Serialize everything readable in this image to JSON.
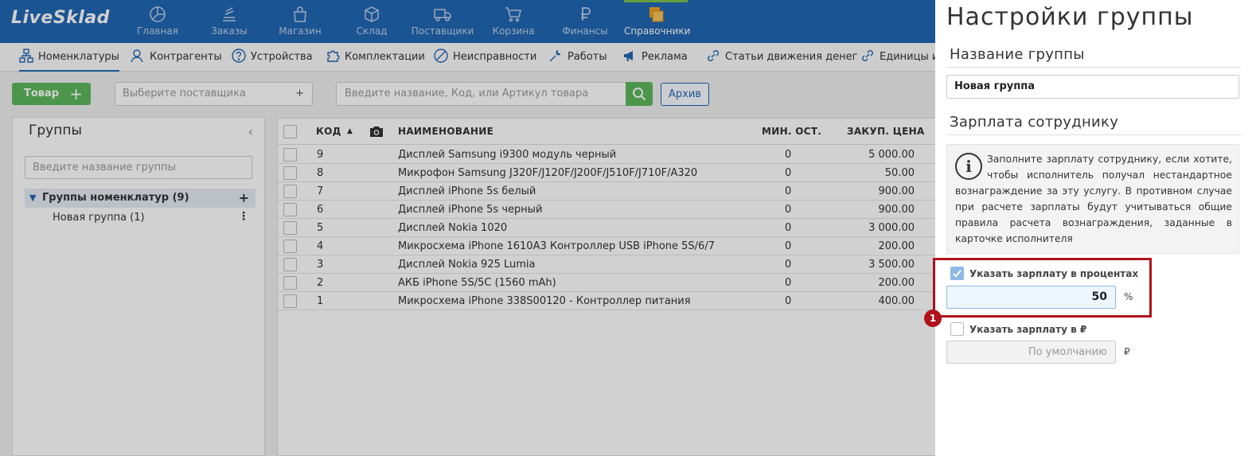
{
  "app": {
    "logo": "LiveSklad"
  },
  "nav": [
    {
      "label": "Главная",
      "icon": "pie-chart-icon"
    },
    {
      "label": "Заказы",
      "icon": "stack-icon"
    },
    {
      "label": "Магазин",
      "icon": "shopping-bag-icon"
    },
    {
      "label": "Склад",
      "icon": "box-icon"
    },
    {
      "label": "Поставщики",
      "icon": "truck-icon"
    },
    {
      "label": "Корзина",
      "icon": "cart-icon"
    },
    {
      "label": "Финансы",
      "icon": "ruble-icon"
    },
    {
      "label": "Справочники",
      "icon": "reference-icon",
      "active": true
    }
  ],
  "subnav": [
    {
      "label": "Номенклатуры",
      "icon": "nomenclature-icon",
      "active": true
    },
    {
      "label": "Контрагенты",
      "icon": "person-icon"
    },
    {
      "label": "Устройства",
      "icon": "question-circle-icon"
    },
    {
      "label": "Комплектации",
      "icon": "puzzle-icon"
    },
    {
      "label": "Неисправности",
      "icon": "forbidden-icon"
    },
    {
      "label": "Работы",
      "icon": "wrench-icon"
    },
    {
      "label": "Реклама",
      "icon": "megaphone-icon"
    },
    {
      "label": "Статьи движения денег",
      "icon": "link-icon"
    },
    {
      "label": "Единицы из",
      "icon": "link-icon"
    }
  ],
  "toolbar": {
    "add_label": "Товар",
    "add_plus": "+",
    "supplier_placeholder": "Выберите поставщика",
    "supplier_plus": "+",
    "search_placeholder": "Введите название, Код, или Артикул товара",
    "archive_label": "Архив"
  },
  "groups": {
    "title": "Группы",
    "collapse": "‹",
    "search_placeholder": "Введите название группы",
    "root": {
      "label": "Группы номенклатур (9)",
      "chevron": "▼",
      "plus": "+"
    },
    "child": {
      "label": "Новая группа (1)",
      "menu": "⋮"
    }
  },
  "table": {
    "headers": {
      "code": "КОД",
      "sort": "▲",
      "name": "НАИМЕНОВАНИЕ",
      "min_stock": "МИН. ОСТ.",
      "purchase_price": "ЗАКУП. ЦЕНА"
    },
    "rows": [
      {
        "code": "9",
        "name": "Дисплей Samsung i9300 модуль черный",
        "min": "0",
        "price": "5 000.00"
      },
      {
        "code": "8",
        "name": "Микрофон Samsung J320F/J120F/J200F/J510F/J710F/A320",
        "min": "0",
        "price": "50.00"
      },
      {
        "code": "7",
        "name": "Дисплей iPhone 5s белый",
        "min": "0",
        "price": "900.00"
      },
      {
        "code": "6",
        "name": "Дисплей iPhone 5s черный",
        "min": "0",
        "price": "900.00"
      },
      {
        "code": "5",
        "name": "Дисплей Nokia 1020",
        "min": "0",
        "price": "3 000.00"
      },
      {
        "code": "4",
        "name": "Микросхема iPhone 1610A3 Контроллер USB iPhone 5S/6/7",
        "min": "0",
        "price": "200.00"
      },
      {
        "code": "3",
        "name": "Дисплей Nokia 925 Lumia",
        "min": "0",
        "price": "3 500.00"
      },
      {
        "code": "2",
        "name": "АКБ iPhone 5S/5C (1560 mAh)",
        "min": "0",
        "price": "200.00"
      },
      {
        "code": "1",
        "name": "Микросхема iPhone 338S00120 - Контроллер питания",
        "min": "0",
        "price": "400.00"
      }
    ]
  },
  "panel": {
    "title": "Настройки группы",
    "name_section": "Название группы",
    "name_value": "Новая группа",
    "salary_section": "Зарплата сотруднику",
    "info_text": "Заполните зарплату сотруднику, если хотите, чтобы исполнитель получал нестандартное вознаграждение за эту услугу. В противном случае при расчете зарплаты будут учитываться общие правила расчета вознаграждения, заданные в карточке исполнителя",
    "info_icon": "i",
    "percent_label": "Указать зарплату в процентах",
    "percent_checked": true,
    "percent_value": "50",
    "percent_unit": "%",
    "ruble_label": "Указать зарплату в ₽",
    "ruble_checked": false,
    "ruble_placeholder": "По умолчанию",
    "ruble_unit": "₽",
    "badge": "1",
    "highlight_color": "#b0121b"
  },
  "colors": {
    "primary": "#2167b3",
    "success": "#5cb85c",
    "accent": "#7ec04d"
  }
}
